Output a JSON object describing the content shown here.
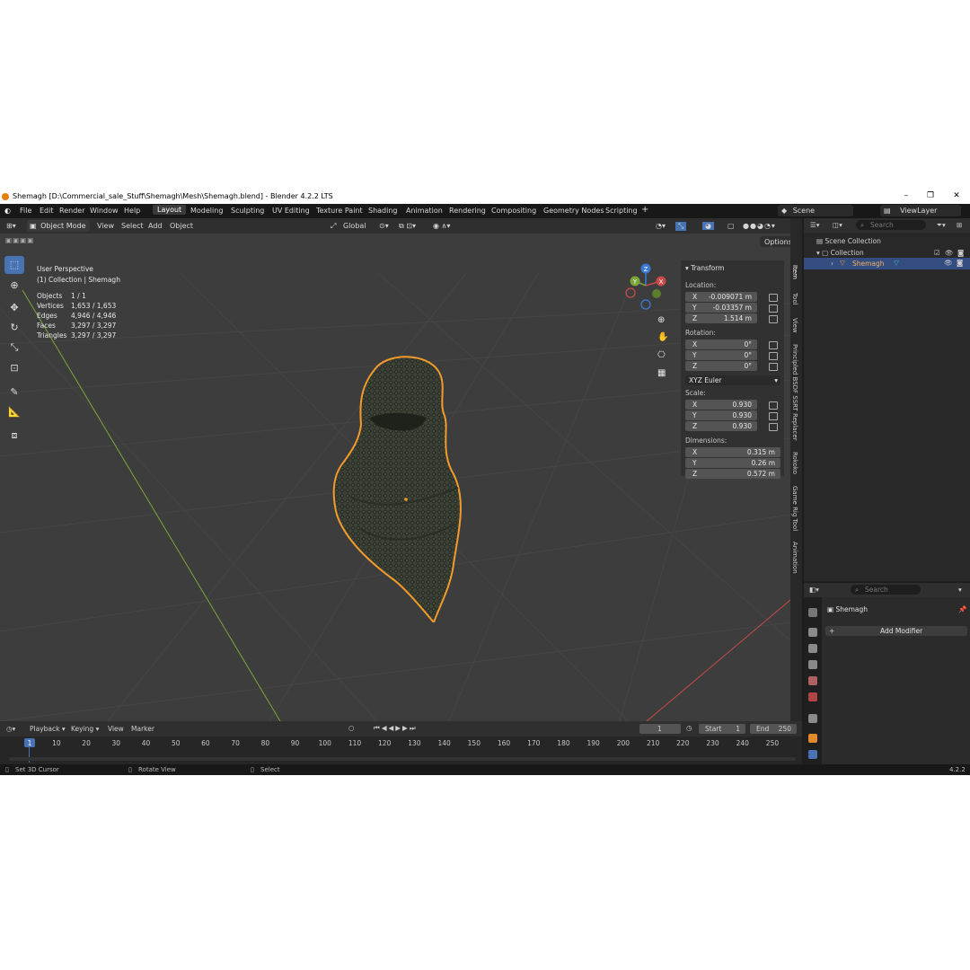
{
  "window": {
    "title": "Shemagh [D:\\Commercial_sale_Stuff\\Shemagh\\Mesh\\Shemagh.blend] - Blender 4.2.2 LTS"
  },
  "menu": [
    "File",
    "Edit",
    "Render",
    "Window",
    "Help"
  ],
  "workspaces": [
    "Layout",
    "Modeling",
    "Sculpting",
    "UV Editing",
    "Texture Paint",
    "Shading",
    "Animation",
    "Rendering",
    "Compositing",
    "Geometry Nodes",
    "Scripting"
  ],
  "active_workspace": "Layout",
  "scene": {
    "scene_name": "Scene",
    "view_layer": "ViewLayer"
  },
  "viewport_header": {
    "mode": "Object Mode",
    "menus": [
      "View",
      "Select",
      "Add",
      "Object"
    ],
    "orientation": "Global",
    "options_label": "Options"
  },
  "overlay": {
    "perspective": "User Perspective",
    "collection_info": "(1) Collection | Shemagh",
    "stats": [
      {
        "label": "Objects",
        "value": "1 / 1"
      },
      {
        "label": "Vertices",
        "value": "1,653 / 1,653"
      },
      {
        "label": "Edges",
        "value": "4,946 / 4,946"
      },
      {
        "label": "Faces",
        "value": "3,297 / 3,297"
      },
      {
        "label": "Triangles",
        "value": "3,297 / 3,297"
      }
    ]
  },
  "gizmo": {
    "x": "X",
    "y": "Y",
    "z": "Z"
  },
  "transform": {
    "header": "Transform",
    "location_label": "Location:",
    "location": [
      {
        "axis": "X",
        "value": "-0.009071 m"
      },
      {
        "axis": "Y",
        "value": "-0.03357 m"
      },
      {
        "axis": "Z",
        "value": "1.514 m"
      }
    ],
    "rotation_label": "Rotation:",
    "rotation": [
      {
        "axis": "X",
        "value": "0°"
      },
      {
        "axis": "Y",
        "value": "0°"
      },
      {
        "axis": "Z",
        "value": "0°"
      }
    ],
    "rotation_mode": "XYZ Euler",
    "scale_label": "Scale:",
    "scale": [
      {
        "axis": "X",
        "value": "0.930"
      },
      {
        "axis": "Y",
        "value": "0.930"
      },
      {
        "axis": "Z",
        "value": "0.930"
      }
    ],
    "dimensions_label": "Dimensions:",
    "dimensions": [
      {
        "axis": "X",
        "value": "0.315 m"
      },
      {
        "axis": "Y",
        "value": "0.26 m"
      },
      {
        "axis": "Z",
        "value": "0.572 m"
      }
    ]
  },
  "sidebar_tabs": [
    "Item",
    "Tool",
    "View",
    "Principled BSDF SSRT Replacer",
    "Rokoko",
    "Game Rig Tool",
    "Animation"
  ],
  "outliner": {
    "search_placeholder": "Search",
    "scene_collection": "Scene Collection",
    "collection": "Collection",
    "object": "Shemagh"
  },
  "properties": {
    "search_placeholder": "Search",
    "object_name": "Shemagh",
    "add_modifier": "Add Modifier"
  },
  "timeline": {
    "menus": [
      "Playback",
      "Keying",
      "View",
      "Marker"
    ],
    "current_frame": "1",
    "start_label": "Start",
    "start": "1",
    "end_label": "End",
    "end": "250",
    "ticks": [
      "1",
      "10",
      "20",
      "30",
      "40",
      "50",
      "60",
      "70",
      "80",
      "90",
      "100",
      "110",
      "120",
      "130",
      "140",
      "150",
      "160",
      "170",
      "180",
      "190",
      "200",
      "210",
      "220",
      "230",
      "240",
      "250"
    ]
  },
  "statusbar": {
    "hint1": "Set 3D Cursor",
    "hint2": "Rotate View",
    "hint3": "Select",
    "version": "4.2.2"
  },
  "colors": {
    "accent": "#4772b3",
    "selection_outline": "#f29b2c",
    "x_axis": "#c84a4a",
    "y_axis": "#7aa53a",
    "z_axis": "#3a7ad6"
  }
}
